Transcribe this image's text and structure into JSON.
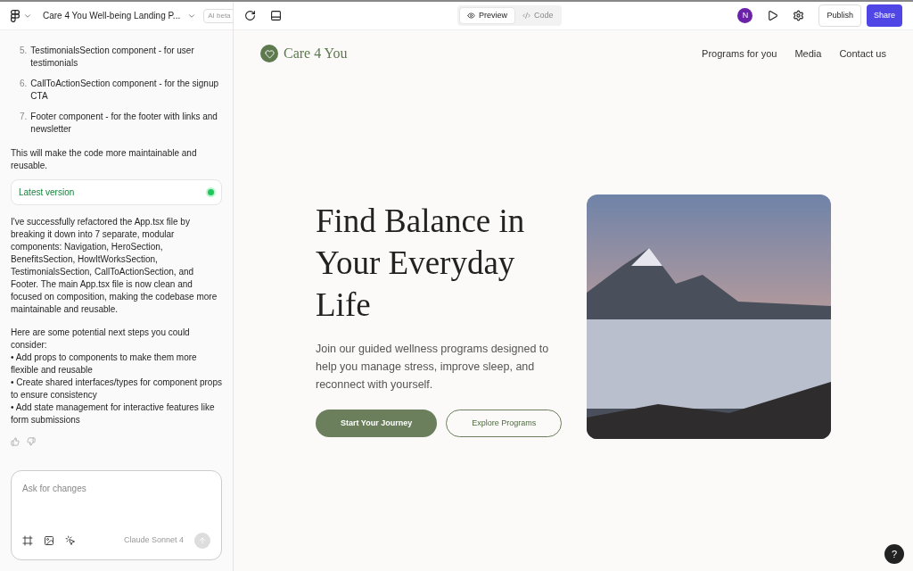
{
  "header": {
    "project_title": "Care 4 You Well-being Landing P...",
    "badge": "AI beta"
  },
  "chat": {
    "list_items": [
      {
        "number": "5.",
        "text": "TestimonialsSection component - for user testimonials"
      },
      {
        "number": "6.",
        "text": "CallToActionSection component - for the signup CTA"
      },
      {
        "number": "7.",
        "text": "Footer component - for the footer with links and newsletter"
      }
    ],
    "note": "This will make the code more maintainable and reusable.",
    "version": {
      "label": "Latest version",
      "active": true
    },
    "reply": [
      "I've successfully refactored the App.tsx file by breaking it down into 7 separate, modular components: Navigation, HeroSection, BenefitsSection, HowItWorksSection, TestimonialsSection, CallToActionSection, and Footer. The main App.tsx file is now clean and focused on composition, making the codebase more maintainable and reusable.",
      "Here are some potential next steps you could consider:\n• Add props to components to make them more flexible and reusable\n• Create shared interfaces/types for component props to ensure consistency\n• Add state management for interactive features like form submissions"
    ],
    "input": {
      "placeholder": "Ask for changes",
      "model": "Claude Sonnet 4"
    }
  },
  "toolbar": {
    "tabs": [
      {
        "label": "Preview",
        "selected": true
      },
      {
        "label": "Code",
        "selected": false
      }
    ],
    "avatar": "N",
    "publish": "Publish",
    "share": "Share"
  },
  "preview": {
    "brand": "Care 4 You",
    "nav": [
      "Programs for you",
      "Media",
      "Contact us"
    ],
    "headline": "Find Balance in Your Everyday Life",
    "subtitle": "Join our guided wellness programs designed to help you manage stress, improve sleep, and reconnect with yourself.",
    "buttons": [
      {
        "label": "Start Your Journey",
        "kind": "primary"
      },
      {
        "label": "Explore Programs",
        "kind": "outline"
      }
    ],
    "help": "?"
  }
}
